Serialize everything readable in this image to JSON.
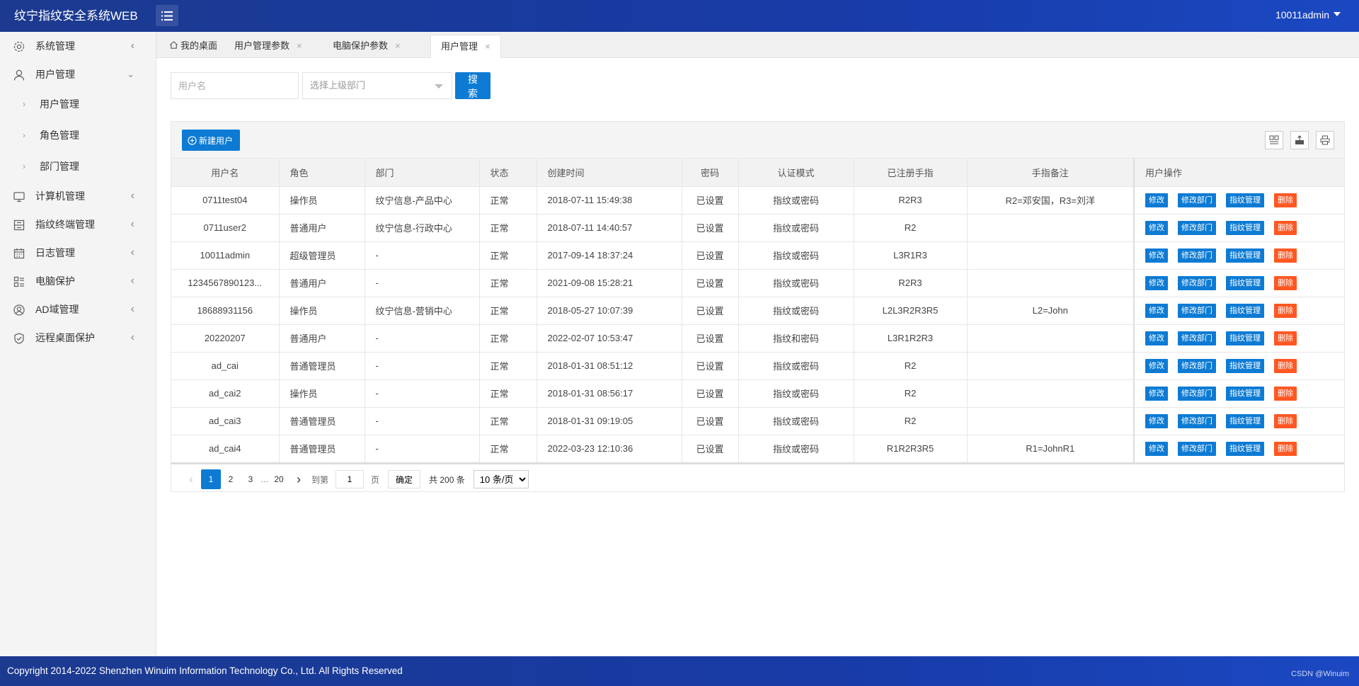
{
  "app": {
    "title": "纹宁指纹安全系统WEB",
    "user": "10011admin"
  },
  "sidebar": {
    "items": [
      {
        "label": "系统管理",
        "icon": "gear-icon"
      },
      {
        "label": "用户管理",
        "icon": "user-icon",
        "expanded": true,
        "children": [
          {
            "label": "用户管理"
          },
          {
            "label": "角色管理"
          },
          {
            "label": "部门管理"
          }
        ]
      },
      {
        "label": "计算机管理",
        "icon": "monitor-icon"
      },
      {
        "label": "指纹终端管理",
        "icon": "terminal-icon"
      },
      {
        "label": "日志管理",
        "icon": "calendar-icon"
      },
      {
        "label": "电脑保护",
        "icon": "apps-icon"
      },
      {
        "label": "AD域管理",
        "icon": "user-circle-icon"
      },
      {
        "label": "远程桌面保护",
        "icon": "shield-icon"
      }
    ]
  },
  "tabs": [
    {
      "label": "我的桌面",
      "icon": "home-icon"
    },
    {
      "label": "用户管理参数",
      "close": "×"
    },
    {
      "label": "电脑保护参数",
      "close": "×"
    },
    {
      "label": "用户管理",
      "close": "×",
      "active": true
    }
  ],
  "search": {
    "username_placeholder": "用户名",
    "dept_placeholder": "选择上级部门",
    "search_label": "搜索"
  },
  "toolbar": {
    "new_user_label": "新建用户"
  },
  "table": {
    "columns": [
      "用户名",
      "角色",
      "部门",
      "状态",
      "创建时间",
      "密码",
      "认证模式",
      "已注册手指",
      "手指备注",
      "用户操作"
    ],
    "rows": [
      [
        "0711test04",
        "操作员",
        "纹宁信息-产品中心",
        "正常",
        "2018-07-11 15:49:38",
        "已设置",
        "指纹或密码",
        "R2R3",
        "R2=邓安国，R3=刘洋"
      ],
      [
        "0711user2",
        "普通用户",
        "纹宁信息-行政中心",
        "正常",
        "2018-07-11 14:40:57",
        "已设置",
        "指纹或密码",
        "R2",
        ""
      ],
      [
        "10011admin",
        "超级管理员",
        "-",
        "正常",
        "2017-09-14 18:37:24",
        "已设置",
        "指纹或密码",
        "L3R1R3",
        ""
      ],
      [
        "1234567890123...",
        "普通用户",
        "-",
        "正常",
        "2021-09-08 15:28:21",
        "已设置",
        "指纹或密码",
        "R2R3",
        ""
      ],
      [
        "18688931156",
        "操作员",
        "纹宁信息-营销中心",
        "正常",
        "2018-05-27 10:07:39",
        "已设置",
        "指纹或密码",
        "L2L3R2R3R5",
        "L2=John"
      ],
      [
        "20220207",
        "普通用户",
        "-",
        "正常",
        "2022-02-07 10:53:47",
        "已设置",
        "指纹和密码",
        "L3R1R2R3",
        ""
      ],
      [
        "ad_cai",
        "普通管理员",
        "-",
        "正常",
        "2018-01-31 08:51:12",
        "已设置",
        "指纹或密码",
        "R2",
        ""
      ],
      [
        "ad_cai2",
        "操作员",
        "-",
        "正常",
        "2018-01-31 08:56:17",
        "已设置",
        "指纹或密码",
        "R2",
        ""
      ],
      [
        "ad_cai3",
        "普通管理员",
        "-",
        "正常",
        "2018-01-31 09:19:05",
        "已设置",
        "指纹或密码",
        "R2",
        ""
      ],
      [
        "ad_cai4",
        "普通管理员",
        "-",
        "正常",
        "2022-03-23 12:10:36",
        "已设置",
        "指纹或密码",
        "R1R2R3R5",
        "R1=JohnR1"
      ]
    ],
    "actions": [
      "修改",
      "修改部门",
      "指纹管理",
      "删除"
    ]
  },
  "pagination": {
    "prev": "‹",
    "next": "›",
    "pages": [
      "1",
      "2",
      "3"
    ],
    "ellipsis": "…",
    "last": "20",
    "current": "1",
    "goto_label": "到第",
    "goto_value": "1",
    "page_unit": "页",
    "confirm": "确定",
    "total": "共 200 条",
    "page_size": "10 条/页"
  },
  "footer": {
    "copyright": "Copyright 2014-2022 Shenzhen Winuim Information Technology Co., Ltd. All Rights Reserved",
    "watermark": "CSDN @Winuim"
  },
  "colors": {
    "header": "#173aa6",
    "primary": "#0d7bd4",
    "danger": "#ff5722"
  }
}
